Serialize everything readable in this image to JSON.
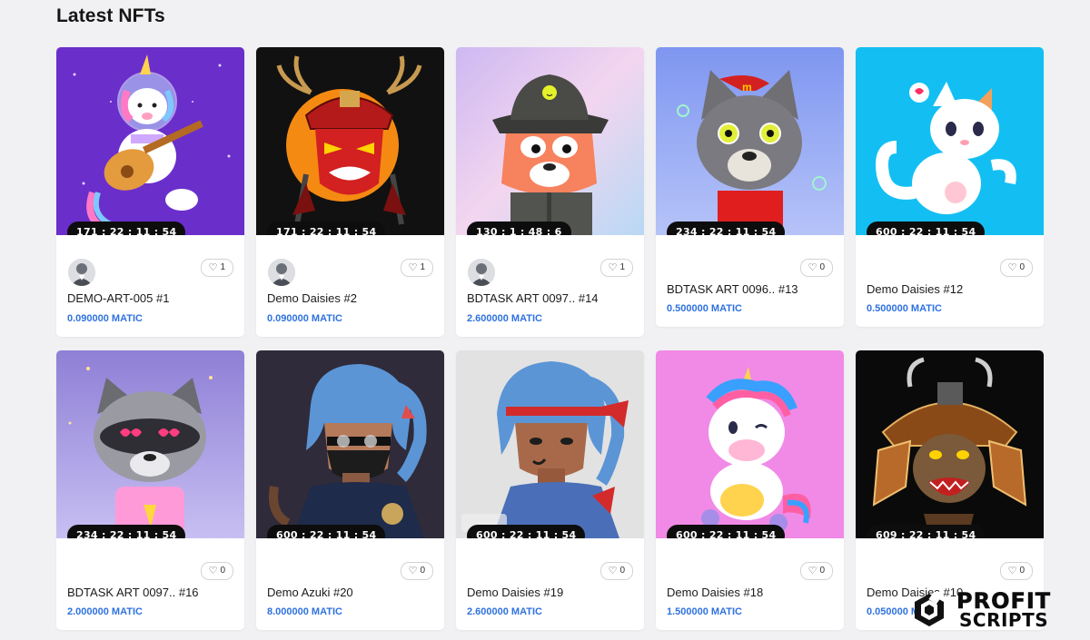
{
  "section": {
    "title": "Latest NFTs"
  },
  "nfts": [
    {
      "name": "DEMO-ART-005 #1",
      "price": "0.090000 MATIC",
      "timer": "171 : 22 : 11 : 54",
      "likes": "1",
      "owner_avatar": true,
      "art": "unicorn-astronaut-guitar",
      "bg": "#6a2ecb"
    },
    {
      "name": "Demo Daisies #2",
      "price": "0.090000 MATIC",
      "timer": "171 : 22 : 11 : 54",
      "likes": "1",
      "owner_avatar": true,
      "art": "samurai-oni-mask",
      "bg": "#111111"
    },
    {
      "name": "BDTASK ART 0097.. #14",
      "price": "2.600000 MATIC",
      "timer": "130 : 1 : 48 : 6",
      "likes": "1",
      "owner_avatar": true,
      "art": "fox-bucket-hat",
      "bg": "#d8c8ee"
    },
    {
      "name": "BDTASK ART 0096.. #13",
      "price": "0.500000 MATIC",
      "timer": "234 : 22 : 11 : 54",
      "likes": "0",
      "owner_avatar": false,
      "art": "wolf-red-shirt",
      "bg": "#8a9ff0"
    },
    {
      "name": "Demo Daisies #12",
      "price": "0.500000 MATIC",
      "timer": "600 : 22 : 11 : 54",
      "likes": "0",
      "owner_avatar": false,
      "art": "cat-heart",
      "bg": "#13bff2"
    },
    {
      "name": "BDTASK ART 0097.. #16",
      "price": "2.000000 MATIC",
      "timer": "234 : 22 : 11 : 54",
      "likes": "0",
      "owner_avatar": false,
      "art": "raccoon-heart-eyes",
      "bg": "#a89ae2"
    },
    {
      "name": "Demo Azuki #20",
      "price": "8.000000 MATIC",
      "timer": "600 : 22 : 11 : 54",
      "likes": "0",
      "owner_avatar": false,
      "art": "azuki-masked",
      "bg": "#2f2b3a"
    },
    {
      "name": "Demo Daisies #19",
      "price": "2.600000 MATIC",
      "timer": "600 : 22 : 11 : 54",
      "likes": "0",
      "owner_avatar": false,
      "art": "azuki-headband",
      "bg": "#e2e2e2"
    },
    {
      "name": "Demo Daisies #18",
      "price": "1.500000 MATIC",
      "timer": "600 : 22 : 11 : 54",
      "likes": "0",
      "owner_avatar": false,
      "art": "unicorn-sitting",
      "bg": "#f08ae6"
    },
    {
      "name": "Demo Daisies #10",
      "price": "0.050000 MATIC",
      "timer": "609 : 22 : 11 : 54",
      "likes": "0",
      "owner_avatar": false,
      "art": "samurai-gorilla",
      "bg": "#0a0a0a"
    }
  ],
  "watermark": {
    "line1": "PROFIT",
    "line2": "SCRIPTS"
  }
}
